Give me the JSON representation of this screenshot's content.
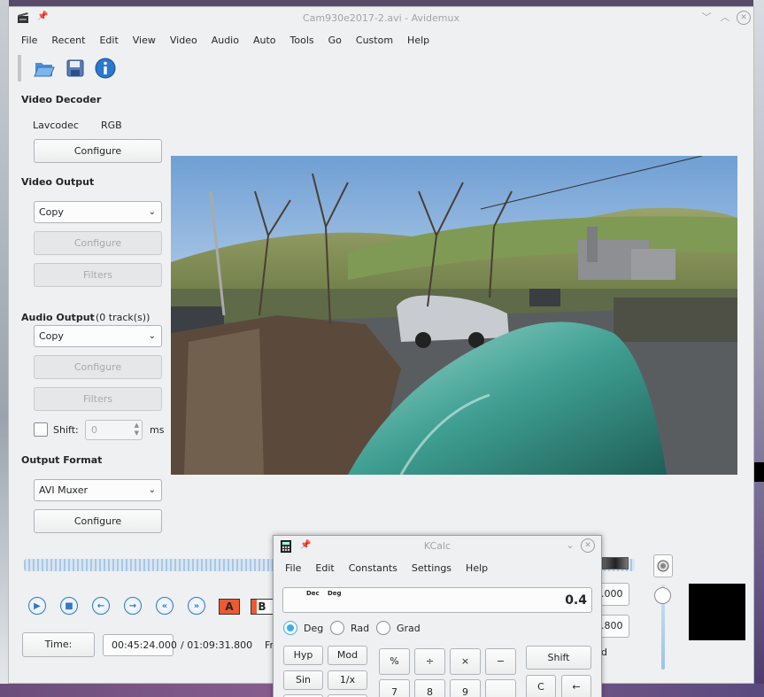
{
  "window": {
    "title": "Cam930e2017-2.avi - Avidemux",
    "controls": {
      "minimize": "﹀",
      "maximize": "︿",
      "close": "✕"
    }
  },
  "menubar": [
    "File",
    "Recent",
    "Edit",
    "View",
    "Video",
    "Audio",
    "Auto",
    "Tools",
    "Go",
    "Custom",
    "Help"
  ],
  "toolbar": {
    "icons": [
      "open-folder-icon",
      "save-disk-icon",
      "info-icon"
    ]
  },
  "video_decoder": {
    "title": "Video Decoder",
    "decoder": "Lavcodec",
    "colorspace": "RGB",
    "configure": "Configure"
  },
  "video_output": {
    "title": "Video Output",
    "codec": "Copy",
    "configure": "Configure",
    "filters": "Filters"
  },
  "audio_output": {
    "title": "Audio Output",
    "tracks": "(0 track(s))",
    "codec": "Copy",
    "configure": "Configure",
    "filters": "Filters",
    "shift_label": "Shift:",
    "shift_value": "0",
    "shift_unit": "ms"
  },
  "output_format": {
    "title": "Output Format",
    "muxer": "AVI Muxer",
    "configure": "Configure"
  },
  "playback": {
    "ab_markers": [
      "A",
      "B"
    ],
    "time_button": "Time:",
    "current_time": "00:45:24.000",
    "total_time": "/ 01:09:31.800",
    "fr_label": "Fr",
    "side_fields": [
      ".000",
      ".800"
    ],
    "d_label": "d"
  },
  "kcalc": {
    "title": "KCalc",
    "menubar": [
      "File",
      "Edit",
      "Constants",
      "Settings",
      "Help"
    ],
    "indicators": [
      "Dec",
      "Deg"
    ],
    "display_value": "0.4",
    "angle_modes": [
      "Deg",
      "Rad",
      "Grad"
    ],
    "selected_mode": "Deg",
    "buttons": {
      "hyp": "Hyp",
      "mod": "Mod",
      "sin": "Sin",
      "inv": "1/x",
      "percent": "%",
      "divide": "÷",
      "multiply": "×",
      "minus": "−",
      "shift": "Shift",
      "seven": "7",
      "eight": "8",
      "nine": "9",
      "clear": "C",
      "backspace": "←"
    }
  },
  "colors": {
    "window_bg": "#eff0f1",
    "accent_blue": "#3daee9",
    "timeline_blue": "#a9c7e3"
  }
}
